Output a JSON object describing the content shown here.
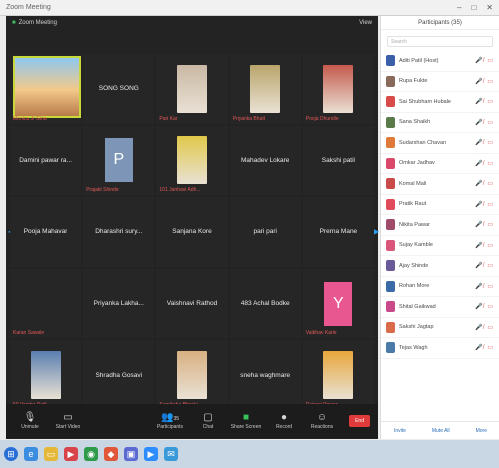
{
  "window": {
    "title": "Zoom Meeting"
  },
  "stage": {
    "top_left": "Zoom Meeting",
    "top_right": "View"
  },
  "tiles": [
    {
      "name": "",
      "tag": "Monica Jr Gina",
      "kind": "big"
    },
    {
      "name": "SONG SONG",
      "tag": "",
      "kind": "text"
    },
    {
      "name": "",
      "tag": "Pari Kar",
      "kind": "photo",
      "color": "#c9b8a4"
    },
    {
      "name": "",
      "tag": "Priyanka Bhatt",
      "kind": "photo",
      "color": "#b9a56a"
    },
    {
      "name": "",
      "tag": "Pooja Dhundle",
      "kind": "photo",
      "color": "#c45a4d"
    },
    {
      "name": "Damini pawar ra...",
      "tag": "",
      "kind": "text"
    },
    {
      "name": "",
      "tag": "Prajakt Shinde",
      "kind": "p"
    },
    {
      "name": "",
      "tag": "101 Janhavi Adh...",
      "kind": "photo",
      "color": "#e0c84a"
    },
    {
      "name": "Mahadev Lokare",
      "tag": "",
      "kind": "text"
    },
    {
      "name": "Sakshi patil",
      "tag": "",
      "kind": "text"
    },
    {
      "name": "Pooja Mahavar",
      "tag": "",
      "kind": "text"
    },
    {
      "name": "Dharashri  sury...",
      "tag": "",
      "kind": "text"
    },
    {
      "name": "Sanjana Kore",
      "tag": "",
      "kind": "text"
    },
    {
      "name": "pari pari",
      "tag": "",
      "kind": "text"
    },
    {
      "name": "Prerna Mane",
      "tag": "",
      "kind": "text"
    },
    {
      "name": "",
      "tag": "Karan Sawale",
      "kind": "empty"
    },
    {
      "name": "Priyanka  Lakha...",
      "tag": "",
      "kind": "text"
    },
    {
      "name": "Vaishnavi Rathod",
      "tag": "",
      "kind": "text"
    },
    {
      "name": "483 Achal Bodke",
      "tag": "",
      "kind": "text"
    },
    {
      "name": "",
      "tag": "Vaibhav Karle",
      "kind": "y"
    },
    {
      "name": "",
      "tag": "50 Varsha Patil",
      "kind": "photo",
      "color": "#5a7fb0"
    },
    {
      "name": "Shradha Gosavi",
      "tag": "",
      "kind": "text"
    },
    {
      "name": "",
      "tag": "Samiksha Bhosle",
      "kind": "photo",
      "color": "#d8b082"
    },
    {
      "name": "sneha waghmare",
      "tag": "",
      "kind": "text"
    },
    {
      "name": "",
      "tag": "Ruturaj Pawar",
      "kind": "photo",
      "color": "#e7a63b"
    }
  ],
  "toolbar": {
    "unmute": "Unmute",
    "video": "Start Video",
    "participants": "Participants",
    "participants_count": "35",
    "chat": "Chat",
    "share": "Share Screen",
    "record": "Record",
    "reactions": "Reactions",
    "end": "End"
  },
  "panel": {
    "title": "Participants (35)",
    "search_placeholder": "Search",
    "participants": [
      {
        "name": "Aditi Patil (Host)",
        "color": "#3b5ea8"
      },
      {
        "name": "Rupa Fukte",
        "color": "#8a6a5a"
      },
      {
        "name": "Sai Shubham Hubale",
        "color": "#d94a4a"
      },
      {
        "name": "Sana Shaikh",
        "color": "#5a7a4a"
      },
      {
        "name": "Sudarshan Chavan",
        "color": "#e07a3a"
      },
      {
        "name": "Omkar Jadhav",
        "color": "#d94a6a"
      },
      {
        "name": "Komal Mali",
        "color": "#c94a4a"
      },
      {
        "name": "Pratik Raut",
        "color": "#e04a5a"
      },
      {
        "name": "Nikita Pawar",
        "color": "#a04a6a"
      },
      {
        "name": "Sujay Kamble",
        "color": "#d9567a"
      },
      {
        "name": "Ajay Shinde",
        "color": "#6a5a9a"
      },
      {
        "name": "Rohan More",
        "color": "#3a6aa8"
      },
      {
        "name": "Shital Gaikwad",
        "color": "#c94a8a"
      },
      {
        "name": "Sakshi Jagtap",
        "color": "#d96a4a"
      },
      {
        "name": "Tejas Wagh",
        "color": "#4a7aa8"
      }
    ],
    "footer": [
      "Invite",
      "Mute All",
      "More"
    ]
  },
  "taskbar": {
    "time": "",
    "date": ""
  }
}
